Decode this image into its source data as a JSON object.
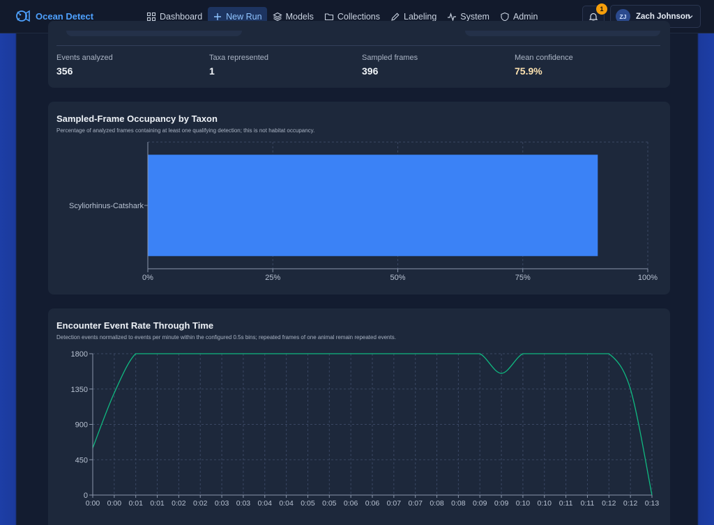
{
  "app": {
    "name": "Ocean Detect"
  },
  "nav": {
    "items": [
      {
        "label": "Dashboard",
        "icon": "dashboard-grid-icon"
      },
      {
        "label": "New Run",
        "icon": "plus-icon",
        "active": true
      },
      {
        "label": "Models",
        "icon": "layers-icon"
      },
      {
        "label": "Collections",
        "icon": "folder-icon"
      },
      {
        "label": "Labeling",
        "icon": "pencil-icon"
      },
      {
        "label": "System",
        "icon": "activity-icon"
      },
      {
        "label": "Admin",
        "icon": "shield-icon"
      }
    ]
  },
  "notifications": {
    "count": "1",
    "icon": "bell-icon"
  },
  "user": {
    "initials": "ZJ",
    "name": "Zach Johnson"
  },
  "stats": [
    {
      "label": "Events analyzed",
      "value": "356"
    },
    {
      "label": "Taxa represented",
      "value": "1"
    },
    {
      "label": "Sampled frames",
      "value": "396"
    },
    {
      "label": "Mean confidence",
      "value": "75.9%"
    }
  ],
  "occupancy": {
    "title": "Sampled-Frame Occupancy by Taxon",
    "subtitle": "Percentage of analyzed frames containing at least one qualifying detection; this is not habitat occupancy."
  },
  "encounter": {
    "title": "Encounter Event Rate Through Time",
    "subtitle": "Detection events normalized to events per minute within the configured 0.5s bins; repeated frames of one animal remain repeated events."
  },
  "colors": {
    "bar": "#3b82f6",
    "line": "#10b981",
    "accent": "#4ea1ff",
    "badge": "#f59e0b"
  },
  "chart_data": [
    {
      "type": "bar",
      "orientation": "horizontal",
      "categories": [
        "Scyliorhinus-Catshark"
      ],
      "values": [
        90
      ],
      "xlim": [
        0,
        100
      ],
      "xticks": [
        "0%",
        "25%",
        "50%",
        "75%",
        "100%"
      ],
      "grid": true
    },
    {
      "type": "line",
      "x": [
        0,
        1,
        2,
        3,
        4,
        5,
        6,
        7,
        8,
        9,
        10,
        11,
        12,
        13,
        14,
        15,
        16,
        17,
        18,
        19,
        20,
        21,
        22,
        23,
        24,
        25,
        26
      ],
      "values": [
        600,
        1300,
        1800,
        1800,
        1800,
        1800,
        1800,
        1800,
        1800,
        1800,
        1800,
        1800,
        1800,
        1800,
        1800,
        1800,
        1800,
        1800,
        1800,
        1550,
        1800,
        1800,
        1800,
        1800,
        1800,
        1350,
        0
      ],
      "ylim": [
        0,
        1800
      ],
      "yticks": [
        "0",
        "450",
        "900",
        "1350",
        "1800"
      ],
      "xticks": [
        "0:00",
        "0:00",
        "0:01",
        "0:01",
        "0:02",
        "0:02",
        "0:03",
        "0:03",
        "0:04",
        "0:04",
        "0:05",
        "0:05",
        "0:06",
        "0:06",
        "0:07",
        "0:07",
        "0:08",
        "0:08",
        "0:09",
        "0:09",
        "0:10",
        "0:10",
        "0:11",
        "0:11",
        "0:12",
        "0:12",
        "0:13"
      ],
      "grid": true
    }
  ]
}
